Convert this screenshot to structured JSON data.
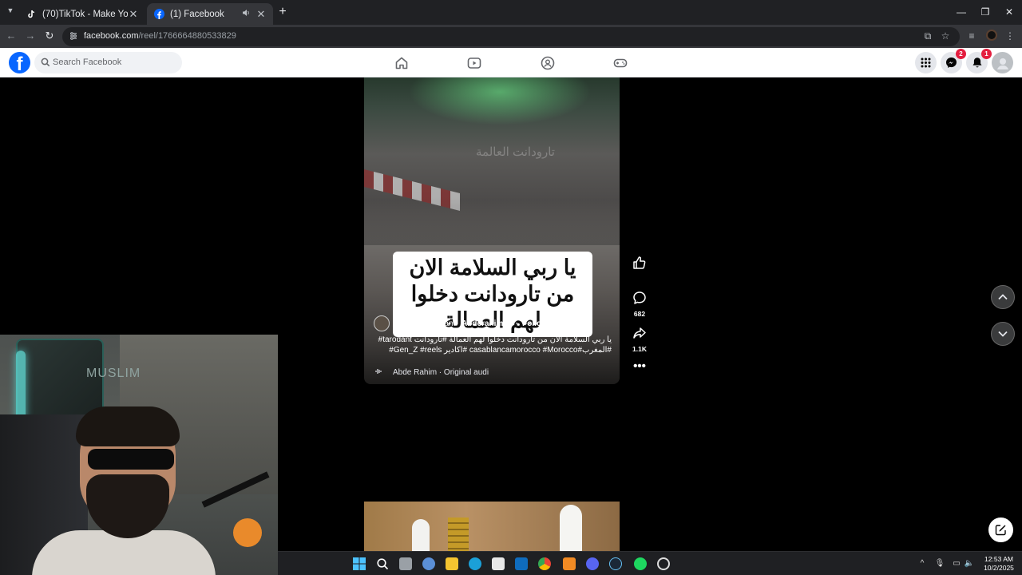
{
  "browser": {
    "tabs": [
      {
        "title": "(70)TikTok - Make Your Day",
        "active": false
      },
      {
        "title": "(1) Facebook",
        "active": true
      }
    ],
    "url_domain": "facebook.com",
    "url_path": "/reel/1766664880533829"
  },
  "facebook": {
    "search_placeholder": "Search Facebook",
    "messenger_badge": "2",
    "notifications_badge": "1"
  },
  "reel": {
    "overlay_caption": "يا ربي السلامة الان من تارودانت دخلوا لهم العمالة",
    "watermark": "تارودانت العالمة",
    "owner": "Abde Rahim",
    "and_text": "and",
    "coauthor": "Abderahim G",
    "follow_label": "Follow",
    "description_line1": "يا ربي السلامة الان من تارودانت دخلوا لهم العمالة #تارودانت tarodant#",
    "description_line2": "#المغرب#casablancamorocco #Morocco #اكادير Gen_Z #reels#",
    "audio": "Abde Rahim · Original audi",
    "comments_count": "682",
    "shares_count": "1.1K"
  },
  "webcam": {
    "sign_text": "MUSLIM"
  },
  "taskbar": {
    "time": "12:53 AM",
    "date": "10/2/2025"
  },
  "colors": {
    "facebook_blue": "#0866ff",
    "badge_red": "#e41e3f",
    "chrome_dark": "#202124",
    "chrome_toolbar": "#35363a"
  }
}
